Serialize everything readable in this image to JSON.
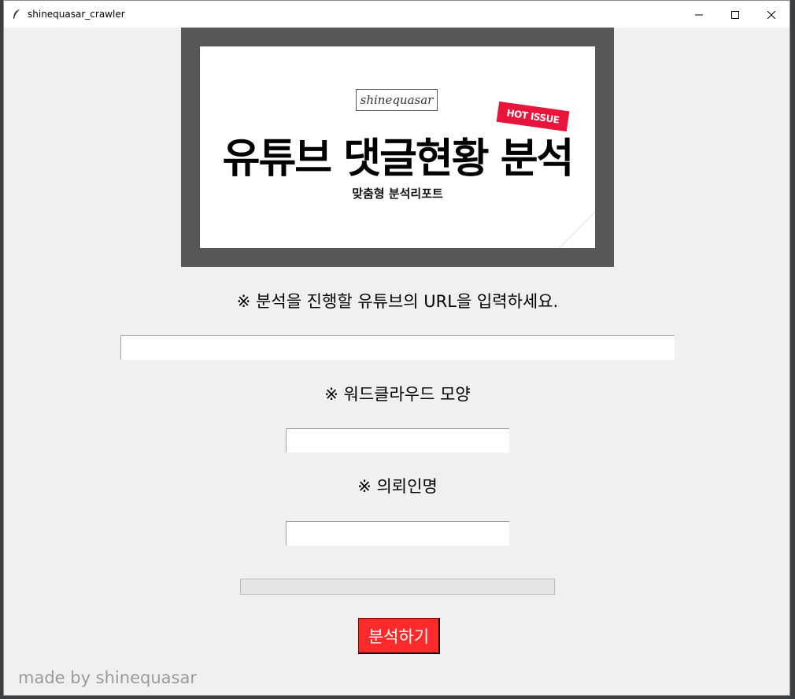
{
  "window": {
    "title": "shinequasar_crawler"
  },
  "banner": {
    "brand": "shinequasar",
    "badge": "HOT ISSUE",
    "title": "유튜브 댓글현황 분석",
    "subtitle": "맞춤형 분석리포트"
  },
  "form": {
    "url_label": "※ 분석을 진행할 유튜브의 URL을 입력하세요.",
    "url_value": "",
    "shape_label": "※ 워드클라우드 모양",
    "shape_value": "",
    "client_label": "※ 의뢰인명",
    "client_value": "",
    "progress": 0,
    "analyze_button": "분석하기"
  },
  "footer": {
    "credit": "made by shinequasar"
  },
  "colors": {
    "button_bg": "#ff2b2b",
    "window_bg": "#f0f0f0",
    "banner_frame": "#575757",
    "badge": "#e8143c"
  },
  "icons": {
    "app": "feather-icon",
    "minimize": "minimize-icon",
    "maximize": "maximize-icon",
    "close": "close-icon"
  }
}
